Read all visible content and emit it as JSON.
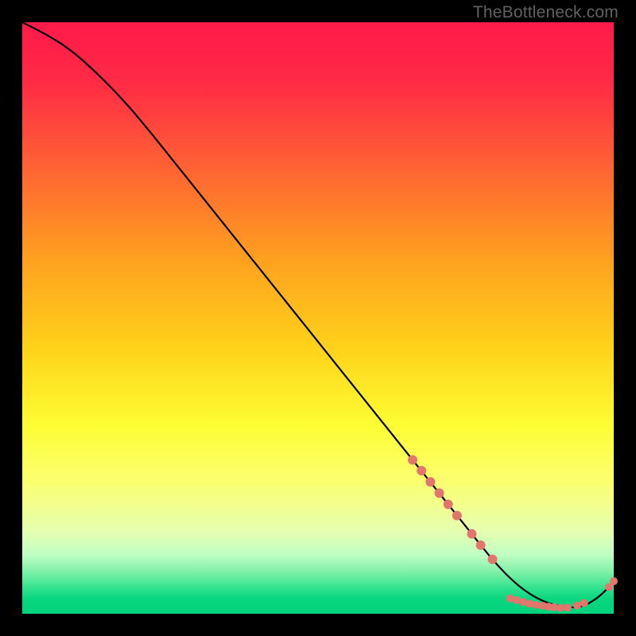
{
  "watermark": "TheBottleneck.com",
  "chart_data": {
    "type": "line",
    "xlim": [
      0,
      100
    ],
    "ylim": [
      0,
      100
    ],
    "grid": false,
    "title": "",
    "xlabel": "",
    "ylabel": "",
    "background_gradient": {
      "stops": [
        {
          "offset": 0.0,
          "color": "#ff1a4b"
        },
        {
          "offset": 0.1,
          "color": "#ff2a45"
        },
        {
          "offset": 0.25,
          "color": "#ff6433"
        },
        {
          "offset": 0.4,
          "color": "#ffa01f"
        },
        {
          "offset": 0.55,
          "color": "#ffd21a"
        },
        {
          "offset": 0.68,
          "color": "#fdfd33"
        },
        {
          "offset": 0.78,
          "color": "#fbff72"
        },
        {
          "offset": 0.86,
          "color": "#e6ffb0"
        },
        {
          "offset": 0.9,
          "color": "#c0ffc4"
        },
        {
          "offset": 0.93,
          "color": "#7df0a8"
        },
        {
          "offset": 0.955,
          "color": "#35e38f"
        },
        {
          "offset": 0.975,
          "color": "#09d67f"
        },
        {
          "offset": 1.0,
          "color": "#00d47e"
        }
      ]
    },
    "series": [
      {
        "name": "bottleneck-curve",
        "color": "#000000",
        "x": [
          0,
          4,
          8,
          12,
          16,
          20,
          30,
          40,
          50,
          60,
          66,
          72,
          76,
          80,
          84,
          88,
          92,
          95,
          98,
          100
        ],
        "y": [
          100,
          98,
          95.5,
          92,
          88,
          83.5,
          71,
          58.5,
          46,
          33.5,
          26,
          18.5,
          13.5,
          8.5,
          4.5,
          2,
          1,
          1.2,
          3.2,
          5.5
        ]
      }
    ],
    "markers": [
      {
        "x": 66.0,
        "y": 26.0,
        "r": 6
      },
      {
        "x": 67.5,
        "y": 24.2,
        "r": 6
      },
      {
        "x": 69.0,
        "y": 22.3,
        "r": 6
      },
      {
        "x": 70.5,
        "y": 20.4,
        "r": 6
      },
      {
        "x": 72.0,
        "y": 18.5,
        "r": 6
      },
      {
        "x": 73.5,
        "y": 16.6,
        "r": 6
      },
      {
        "x": 76.0,
        "y": 13.5,
        "r": 6
      },
      {
        "x": 77.5,
        "y": 11.6,
        "r": 6
      },
      {
        "x": 79.5,
        "y": 9.2,
        "r": 6
      },
      {
        "x": 82.5,
        "y": 2.6,
        "r": 5
      },
      {
        "x": 83.6,
        "y": 2.3,
        "r": 5
      },
      {
        "x": 84.7,
        "y": 2.0,
        "r": 5
      },
      {
        "x": 85.8,
        "y": 1.7,
        "r": 5
      },
      {
        "x": 86.9,
        "y": 1.5,
        "r": 5
      },
      {
        "x": 88.0,
        "y": 1.35,
        "r": 5
      },
      {
        "x": 89.0,
        "y": 1.2,
        "r": 5
      },
      {
        "x": 89.9,
        "y": 1.1,
        "r": 5
      },
      {
        "x": 91.0,
        "y": 1.0,
        "r": 5
      },
      {
        "x": 92.2,
        "y": 1.05,
        "r": 5
      },
      {
        "x": 93.8,
        "y": 1.4,
        "r": 5
      },
      {
        "x": 95.0,
        "y": 1.8,
        "r": 5
      },
      {
        "x": 99.2,
        "y": 4.5,
        "r": 5
      },
      {
        "x": 100.0,
        "y": 5.5,
        "r": 5
      }
    ],
    "marker_color": "#e2766d"
  }
}
